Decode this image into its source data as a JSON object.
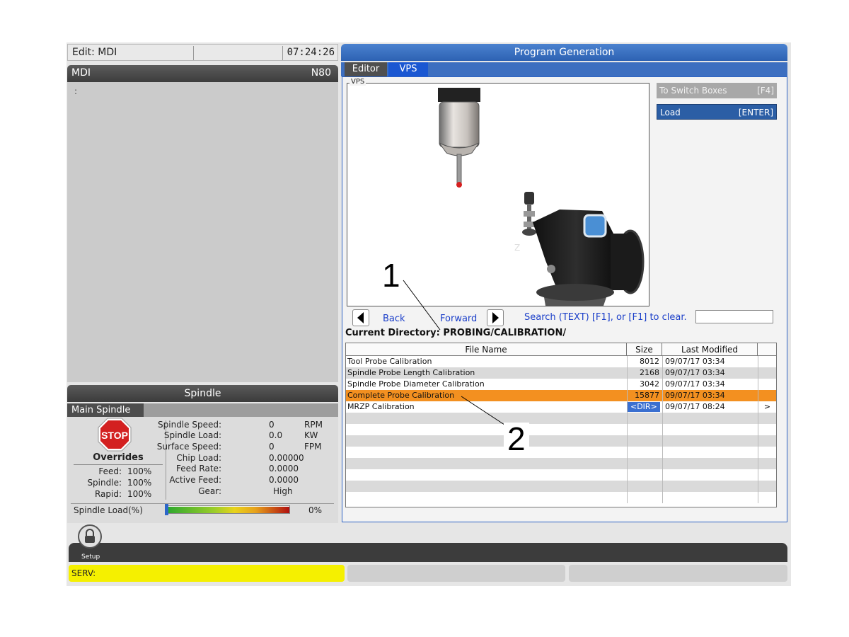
{
  "header": {
    "mode": "Edit: MDI",
    "clock": "07:24:26"
  },
  "mdi": {
    "title": "MDI",
    "line": "N80",
    "cursor": ":"
  },
  "spindle": {
    "title": "Spindle",
    "tab": "Main Spindle",
    "stop_label": "STOP",
    "overrides": {
      "title": "Overrides",
      "rows": [
        {
          "label": "Feed:",
          "value": "100%"
        },
        {
          "label": "Spindle:",
          "value": "100%"
        },
        {
          "label": "Rapid:",
          "value": "100%"
        }
      ]
    },
    "stats": [
      {
        "label": "Spindle Speed:",
        "value": "0",
        "unit": "RPM"
      },
      {
        "label": "Spindle Load:",
        "value": "0.0",
        "unit": "KW"
      },
      {
        "label": "Surface Speed:",
        "value": "0",
        "unit": "FPM"
      },
      {
        "label": "Chip Load:",
        "value": "0.00000",
        "unit": ""
      },
      {
        "label": "Feed Rate:",
        "value": "0.0000",
        "unit": ""
      },
      {
        "label": "Active Feed:",
        "value": "0.0000",
        "unit": ""
      },
      {
        "label": "Gear:",
        "value": "High",
        "unit": ""
      }
    ],
    "load_label": "Spindle Load(%)",
    "load_value": "0%",
    "load_fraction": 0.0
  },
  "program_generation": {
    "title": "Program Generation",
    "tabs": [
      "Editor",
      "VPS"
    ],
    "active_tab": "VPS",
    "vps_label": "VPS",
    "side_buttons": [
      {
        "label": "To Switch Boxes",
        "key": "[F4]"
      },
      {
        "label": "Load",
        "key": "[ENTER]"
      }
    ],
    "nav": {
      "back": "Back",
      "forward": "Forward",
      "search_hint": "Search (TEXT) [F1], or [F1] to clear.",
      "search_value": ""
    },
    "current_directory_label": "Current Directory:",
    "current_directory": "PROBING/CALIBRATION/",
    "table": {
      "columns": [
        "File Name",
        "Size",
        "Last Modified"
      ],
      "rows": [
        {
          "name": "Tool Probe Calibration",
          "size": "8012",
          "modified": "09/07/17 03:34",
          "arrow": ""
        },
        {
          "name": "Spindle Probe Length Calibration",
          "size": "2168",
          "modified": "09/07/17 03:34",
          "arrow": ""
        },
        {
          "name": "Spindle Probe Diameter Calibration",
          "size": "3042",
          "modified": "09/07/17 03:34",
          "arrow": ""
        },
        {
          "name": "Complete Probe Calibration",
          "size": "15877",
          "modified": "09/07/17 03:34",
          "arrow": ""
        },
        {
          "name": "MRZP Calibration",
          "size": "<DIR>",
          "modified": "09/07/17 08:24",
          "arrow": ">"
        }
      ],
      "selected_row": 3
    },
    "callouts": [
      "1",
      "2"
    ]
  },
  "bottom": {
    "setup_label": "Setup",
    "status_line": "SERV:"
  },
  "colors": {
    "accent_blue": "#2d62b3",
    "selected_row": "#f39020",
    "status_yellow": "#f5f000",
    "stop_red": "#d32020"
  }
}
